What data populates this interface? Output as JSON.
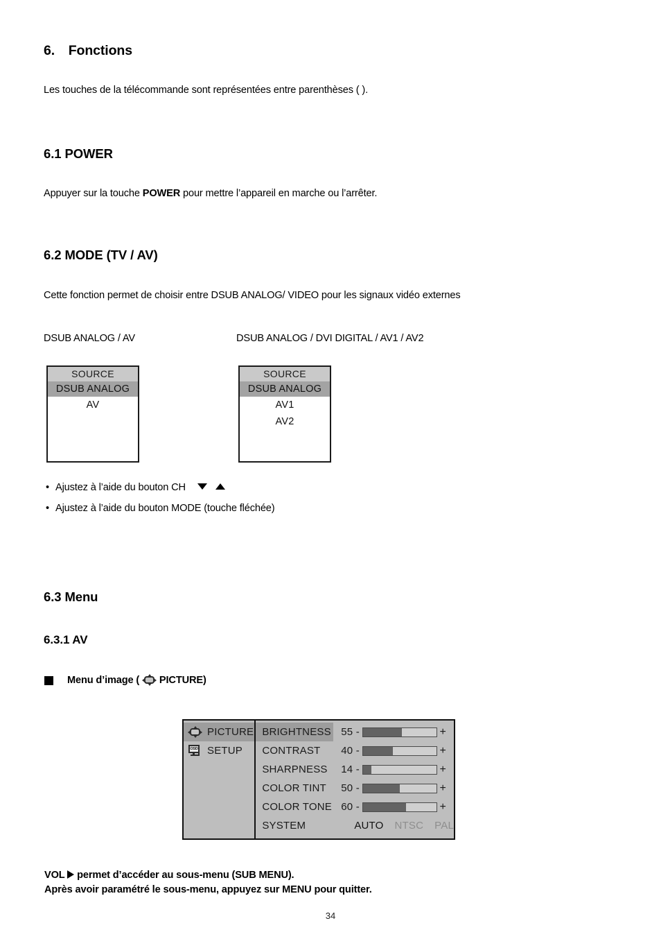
{
  "document": {
    "section_number": "6.",
    "section_title": "Fonctions",
    "intro": "Les touches de la télécommande sont représentées entre parenthèses ( ).",
    "page_number": "34"
  },
  "power": {
    "heading": "6.1  POWER",
    "text_before": "Appuyer sur la touche ",
    "text_bold": "POWER",
    "text_after": " pour mettre l’appareil en marche ou l’arrêter."
  },
  "mode": {
    "heading": "6.2  MODE (TV / AV)",
    "description": "Cette fonction permet de choisir entre DSUB ANALOG/ VIDEO pour les signaux vidéo externes",
    "caption_left": "DSUB ANALOG / AV",
    "caption_right": "DSUB ANALOG / DVI DIGITAL / AV1 / AV2",
    "source_menu_left": {
      "title": "SOURCE",
      "selected": "DSUB ANALOG",
      "items": [
        "AV"
      ]
    },
    "source_menu_right": {
      "title": "SOURCE",
      "selected": "DSUB ANALOG",
      "items": [
        "AV1",
        "AV2"
      ]
    },
    "bullets": [
      "Ajustez à l’aide du bouton CH",
      "Ajustez à l’aide du bouton MODE (touche fléchée)"
    ],
    "bullet_icons": [
      "triangle-down-icon",
      "triangle-up-icon"
    ]
  },
  "menu": {
    "heading": "6.3  Menu",
    "subheading": "6.3.1  AV",
    "picture_label_before": "Menu d’image ( ",
    "picture_label_after": " PICTURE)",
    "osd": {
      "sidebar": [
        {
          "label": "PICTURE",
          "icon": "picture-icon",
          "selected": true
        },
        {
          "label": "SETUP",
          "icon": "osd-icon",
          "selected": false
        }
      ],
      "rows": [
        {
          "label": "BRIGHTNESS",
          "value": "55",
          "minus": "-",
          "plus": "+",
          "fill_pct": 53,
          "selected": true
        },
        {
          "label": "CONTRAST",
          "value": "40",
          "minus": "-",
          "plus": "+",
          "fill_pct": 40,
          "selected": false
        },
        {
          "label": "SHARPNESS",
          "value": "14",
          "minus": "-",
          "plus": "+",
          "fill_pct": 11,
          "selected": false
        },
        {
          "label": "COLOR TINT",
          "value": "50",
          "minus": "-",
          "plus": "+",
          "fill_pct": 50,
          "selected": false
        },
        {
          "label": "COLOR TONE",
          "value": "60",
          "minus": "-",
          "plus": "+",
          "fill_pct": 58,
          "selected": false
        }
      ],
      "system_row": {
        "label": "SYSTEM",
        "options": [
          {
            "label": "AUTO",
            "selected": true
          },
          {
            "label": "NTSC",
            "selected": false
          },
          {
            "label": "PAL",
            "selected": false
          }
        ]
      }
    },
    "footer_line1_before": "VOL ",
    "footer_line1_after": " permet d’accéder au sous-menu (SUB MENU).",
    "footer_line2": "Après avoir paramétré le sous-menu, appuyez sur MENU pour quitter."
  },
  "colors": {
    "osd_bg": "#bebebe",
    "osd_highlight": "#9d9d9d",
    "source_title_bg": "#c9c9c9",
    "source_sel_bg": "#a3a3a3",
    "bar_fill": "#636363",
    "bar_track": "#cfcfcf"
  }
}
